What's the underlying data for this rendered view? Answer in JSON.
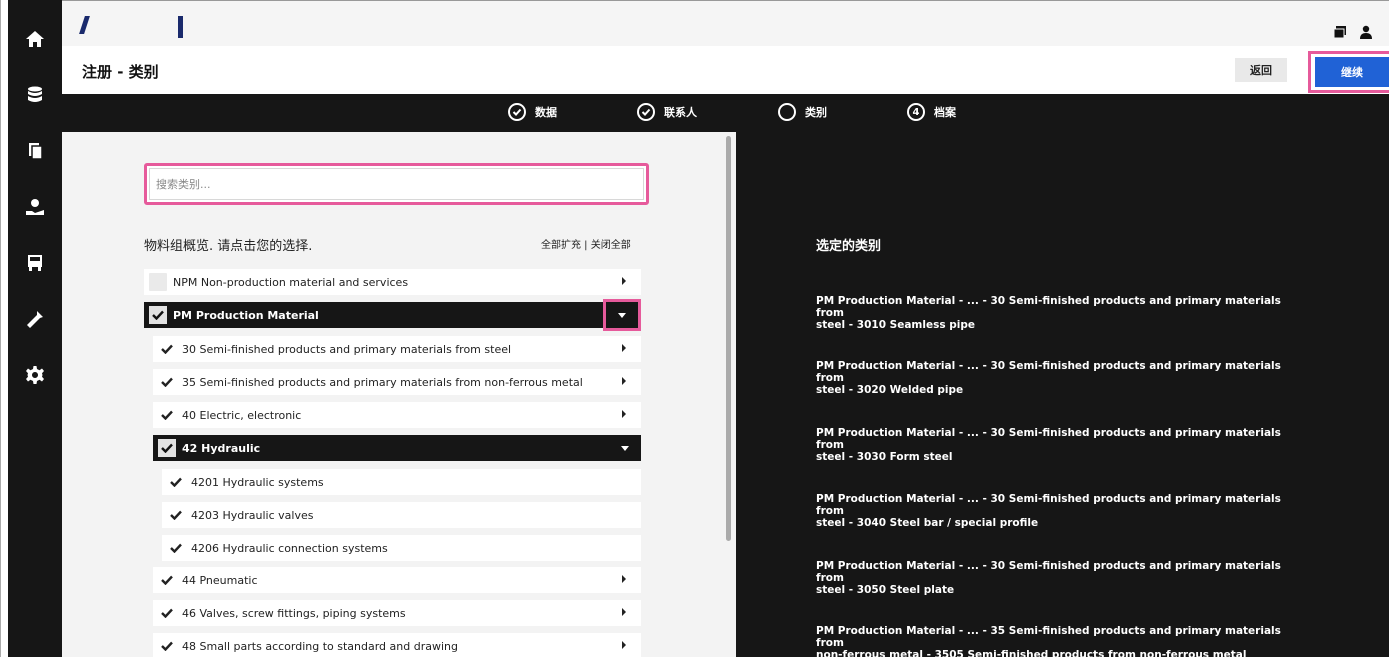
{
  "sidebar": {
    "items": [
      {
        "name": "home-icon"
      },
      {
        "name": "database-icon"
      },
      {
        "name": "documents-icon"
      },
      {
        "name": "support-icon"
      },
      {
        "name": "transport-icon"
      },
      {
        "name": "tools-icon"
      },
      {
        "name": "settings-icon"
      }
    ]
  },
  "header": {
    "utilities": [
      "window-icon",
      "user-icon"
    ]
  },
  "titlebar": {
    "title": "注册 - 类别",
    "back_label": "返回",
    "continue_label": "继续"
  },
  "stepper": {
    "steps": [
      {
        "label": "数据",
        "state": "done",
        "marker": ""
      },
      {
        "label": "联系人",
        "state": "done",
        "marker": ""
      },
      {
        "label": "类别",
        "state": "current",
        "marker": ""
      },
      {
        "label": "档案",
        "state": "todo",
        "marker": "4"
      }
    ]
  },
  "left": {
    "search_placeholder": "搜索类别...",
    "overview_label": "物料组概览. 请点击您的选择.",
    "expand_all": "全部扩充",
    "separator": " | ",
    "collapse_all": "关闭全部",
    "tree": [
      {
        "label": "NPM Non-production material and services",
        "checked": false,
        "expanded": false,
        "level": 0
      },
      {
        "label": "PM Production Material",
        "checked": true,
        "expanded": true,
        "level": 0,
        "selected": true
      },
      {
        "label": "30 Semi-finished products and primary materials from steel",
        "checked": true,
        "expanded": false,
        "level": 1
      },
      {
        "label": "35 Semi-finished products and primary materials from non-ferrous metal",
        "checked": true,
        "expanded": false,
        "level": 1
      },
      {
        "label": "40 Electric, electronic",
        "checked": true,
        "expanded": false,
        "level": 1
      },
      {
        "label": "42 Hydraulic",
        "checked": true,
        "expanded": true,
        "level": 1,
        "selected": true
      },
      {
        "label": "4201 Hydraulic systems",
        "checked": true,
        "level": 2
      },
      {
        "label": "4203 Hydraulic valves",
        "checked": true,
        "level": 2
      },
      {
        "label": "4206 Hydraulic connection systems",
        "checked": true,
        "level": 2
      },
      {
        "label": "44 Pneumatic",
        "checked": true,
        "expanded": false,
        "level": 1
      },
      {
        "label": "46 Valves, screw fittings, piping systems",
        "checked": true,
        "expanded": false,
        "level": 1
      },
      {
        "label": "48 Small parts according to standard and drawing",
        "checked": true,
        "expanded": false,
        "level": 1
      }
    ]
  },
  "right": {
    "title": "选定的类别",
    "selected": [
      {
        "line1": "PM Production Material - ... - 30 Semi-finished products and primary materials from",
        "line2": "steel - 3010 Seamless pipe"
      },
      {
        "line1": "PM Production Material - ... - 30 Semi-finished products and primary materials from",
        "line2": "steel - 3020 Welded pipe"
      },
      {
        "line1": "PM Production Material - ... - 30 Semi-finished products and primary materials from",
        "line2": "steel - 3030 Form steel"
      },
      {
        "line1": "PM Production Material - ... - 30 Semi-finished products and primary materials from",
        "line2": "steel - 3040 Steel bar / special profile"
      },
      {
        "line1": "PM Production Material - ... - 30 Semi-finished products and primary materials from",
        "line2": "steel - 3050 Steel plate"
      },
      {
        "line1": "PM Production Material - ... - 35 Semi-finished products and primary materials from",
        "line2": "non-ferrous metal - 3505 Semi-finished products from non-ferrous metal"
      }
    ]
  },
  "colors": {
    "dark": "#161616",
    "accent_blue": "#2062d6",
    "highlight_pink": "#e65a9b",
    "panel_grey": "#f3f3f3"
  }
}
